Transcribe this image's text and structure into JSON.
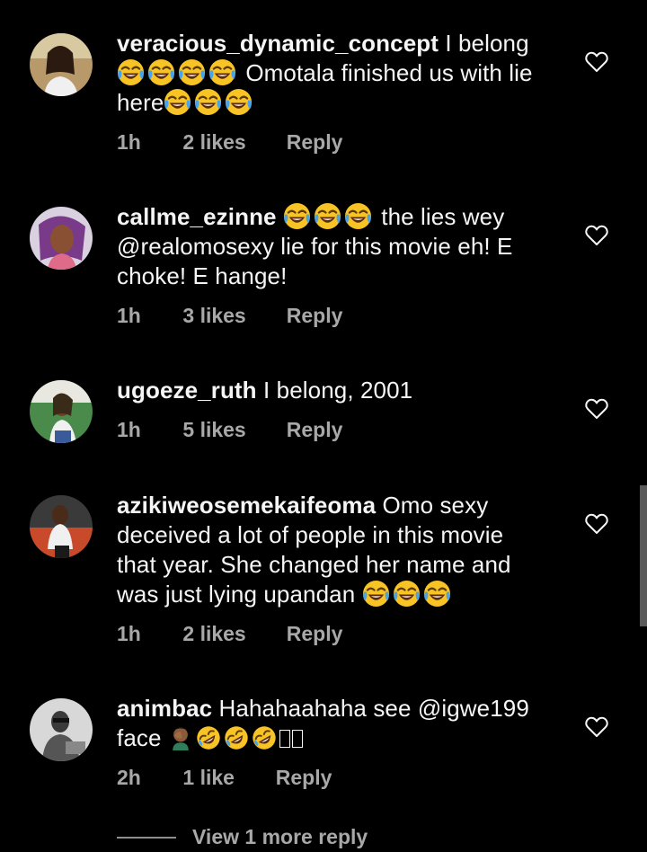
{
  "comments": [
    {
      "username": "veracious_dynamic_concept",
      "text_1": "I belong",
      "text_2": "Omotala finished us with lie",
      "text_3": "here",
      "time": "1h",
      "likes": "2 likes",
      "reply": "Reply"
    },
    {
      "username": "callme_ezinne",
      "text_1": "the lies wey",
      "text_2": "@realomosexy lie for this movie eh! E",
      "text_3": "choke! E hange!",
      "time": "1h",
      "likes": "3 likes",
      "reply": "Reply"
    },
    {
      "username": "ugoeze_ruth",
      "text_1": "I belong, 2001",
      "time": "1h",
      "likes": "5 likes",
      "reply": "Reply"
    },
    {
      "username": "azikiweosemekaifeoma",
      "text_1": "Omo sexy",
      "text_2": "deceived a lot of people in this movie",
      "text_3": "that year. She changed her name and",
      "text_4": "was just lying upandan",
      "time": "1h",
      "likes": "2 likes",
      "reply": "Reply"
    },
    {
      "username": "animbac",
      "text_1": "Hahahaahaha see @igwe199",
      "text_2": "face",
      "time": "2h",
      "likes": "1 like",
      "reply": "Reply"
    }
  ],
  "view_more": "View 1 more reply",
  "icons": {
    "like": "heart-outline-icon",
    "laughing": "face-with-tears-of-joy-emoji",
    "rofl": "rolling-on-floor-laughing-emoji",
    "facepalm": "man-facepalming-emoji"
  },
  "colors": {
    "background": "#000000",
    "text": "#f5f5f5",
    "secondary": "#a8a8a8",
    "emoji": "#f7c325"
  }
}
